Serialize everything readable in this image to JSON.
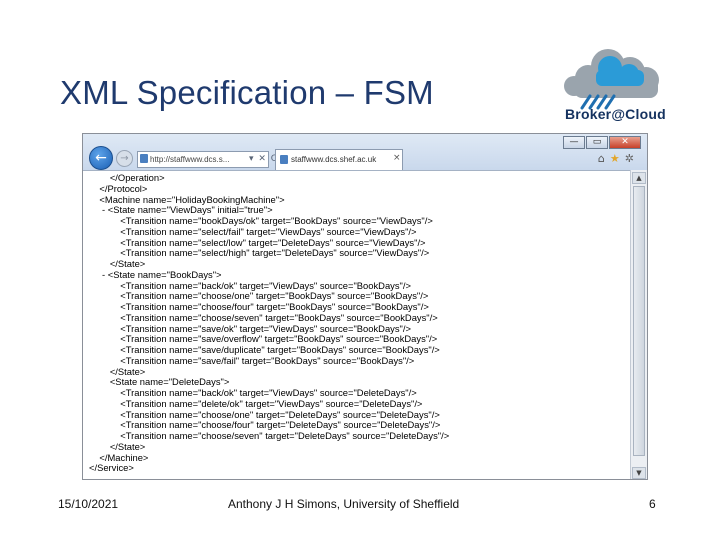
{
  "slide": {
    "title": "XML Specification – FSM",
    "logo_text": "Broker@Cloud",
    "footer_date": "15/10/2021",
    "footer_author": "Anthony J H Simons, University of Sheffield",
    "footer_page": "6"
  },
  "browser": {
    "address": "http://staffwww.dcs.s...",
    "address_buttons": "▾ ✕ C",
    "tab_title": "staffwww.dcs.shef.ac.uk",
    "tab_close": "×",
    "window_min": "—",
    "window_max": "▭",
    "window_close": "✕",
    "back_glyph": "←",
    "forward_glyph": "→",
    "home_glyph": "⌂",
    "star_glyph": "★",
    "gear_glyph": "✲",
    "scroll_up": "▲",
    "scroll_down": "▼"
  },
  "xml_lines": [
    "        </Operation>",
    "    </Protocol>",
    "    <Machine name=\"HolidayBookingMachine\">",
    "     - <State name=\"ViewDays\" initial=\"true\">",
    "            <Transition name=\"bookDays/ok\" target=\"BookDays\" source=\"ViewDays\"/>",
    "            <Transition name=\"select/fail\" target=\"ViewDays\" source=\"ViewDays\"/>",
    "            <Transition name=\"select/low\" target=\"DeleteDays\" source=\"ViewDays\"/>",
    "            <Transition name=\"select/high\" target=\"DeleteDays\" source=\"ViewDays\"/>",
    "        </State>",
    "     - <State name=\"BookDays\">",
    "            <Transition name=\"back/ok\" target=\"ViewDays\" source=\"BookDays\"/>",
    "            <Transition name=\"choose/one\" target=\"BookDays\" source=\"BookDays\"/>",
    "            <Transition name=\"choose/four\" target=\"BookDays\" source=\"BookDays\"/>",
    "            <Transition name=\"choose/seven\" target=\"BookDays\" source=\"BookDays\"/>",
    "            <Transition name=\"save/ok\" target=\"ViewDays\" source=\"BookDays\"/>",
    "            <Transition name=\"save/overflow\" target=\"BookDays\" source=\"BookDays\"/>",
    "            <Transition name=\"save/duplicate\" target=\"BookDays\" source=\"BookDays\"/>",
    "            <Transition name=\"save/fail\" target=\"BookDays\" source=\"BookDays\"/>",
    "        </State>",
    "        <State name=\"DeleteDays\">",
    "            <Transition name=\"back/ok\" target=\"ViewDays\" source=\"DeleteDays\"/>",
    "            <Transition name=\"delete/ok\" target=\"ViewDays\" source=\"DeleteDays\"/>",
    "            <Transition name=\"choose/one\" target=\"DeleteDays\" source=\"DeleteDays\"/>",
    "            <Transition name=\"choose/four\" target=\"DeleteDays\" source=\"DeleteDays\"/>",
    "            <Transition name=\"choose/seven\" target=\"DeleteDays\" source=\"DeleteDays\"/>",
    "        </State>",
    "    </Machine>",
    "</Service>"
  ]
}
